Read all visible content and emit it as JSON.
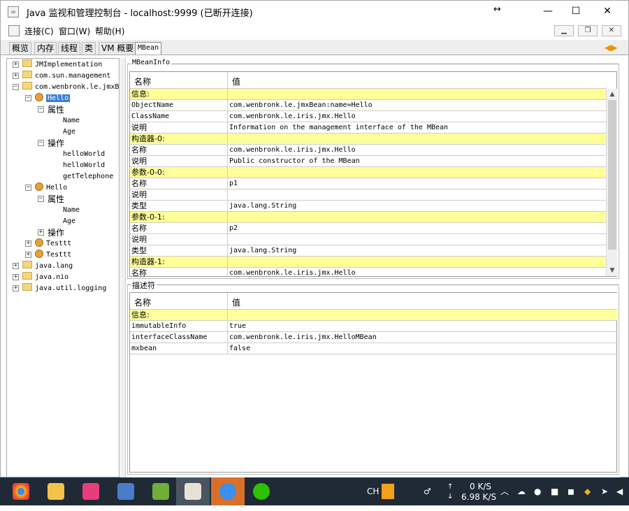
{
  "window": {
    "title": "Java 监视和管理控制台 - localhost:9999 (已断开连接)",
    "resize_glyph": "↔",
    "minimize": "—",
    "maximize": "☐",
    "close": "✕"
  },
  "menu": {
    "items": [
      "连接(C)",
      "窗口(W)",
      "帮助(H)"
    ],
    "mdi": [
      "▁",
      "❐",
      "✕"
    ]
  },
  "tabs": [
    "概览",
    "内存",
    "线程",
    "类",
    "VM 概要",
    "MBean"
  ],
  "active_tab": "MBean",
  "tab_arrows": "◀▶",
  "tree": [
    {
      "label": "JMImplementation",
      "toggle": "+",
      "icon": "folder-icon"
    },
    {
      "label": "com.sun.management",
      "toggle": "+",
      "icon": "folder-icon"
    },
    {
      "label": "com.wenbronk.le.jmxB",
      "toggle": "−",
      "icon": "folder-icon"
    },
    {
      "label": "Hello",
      "toggle": "−",
      "icon": "bean-icon",
      "selected": true
    },
    {
      "label": "属性",
      "toggle": "−",
      "icon": "none"
    },
    {
      "label": "Name",
      "toggle": "",
      "icon": "none"
    },
    {
      "label": "Age",
      "toggle": "",
      "icon": "none"
    },
    {
      "label": "操作",
      "toggle": "−",
      "icon": "none"
    },
    {
      "label": "helloWorld",
      "toggle": "",
      "icon": "none"
    },
    {
      "label": "helloWorld",
      "toggle": "",
      "icon": "none"
    },
    {
      "label": "getTelephone",
      "toggle": "",
      "icon": "none"
    },
    {
      "label": "Hello",
      "toggle": "−",
      "icon": "bean-icon"
    },
    {
      "label": "属性",
      "toggle": "−",
      "icon": "none"
    },
    {
      "label": "Name",
      "toggle": "",
      "icon": "none"
    },
    {
      "label": "Age",
      "toggle": "",
      "icon": "none"
    },
    {
      "label": "操作",
      "toggle": "+",
      "icon": "none"
    },
    {
      "label": "Testtt",
      "toggle": "+",
      "icon": "bean-icon"
    },
    {
      "label": "Testtt",
      "toggle": "+",
      "icon": "bean-icon"
    },
    {
      "label": "java.lang",
      "toggle": "+",
      "icon": "folder-icon"
    },
    {
      "label": "java.nio",
      "toggle": "+",
      "icon": "folder-icon"
    },
    {
      "label": "java.util.logging",
      "toggle": "+",
      "icon": "folder-icon"
    }
  ],
  "mbeaninfo": {
    "title": "MBeanInfo",
    "col_name": "名称",
    "col_value": "值",
    "rows": [
      {
        "name": "信息:",
        "value": "",
        "hl": true
      },
      {
        "name": "ObjectName",
        "value": "com.wenbronk.le.jmxBean:name=Hello"
      },
      {
        "name": "ClassName",
        "value": "com.wenbronk.le.iris.jmx.Hello"
      },
      {
        "name": "说明",
        "value": "Information on the management interface of the MBean"
      },
      {
        "name": "构造器-0:",
        "value": "",
        "hl": true
      },
      {
        "name": "名称",
        "value": "com.wenbronk.le.iris.jmx.Hello"
      },
      {
        "name": "说明",
        "value": "Public constructor of the MBean"
      },
      {
        "name": "参数-0-0:",
        "value": "",
        "hl": true
      },
      {
        "name": "名称",
        "value": "p1"
      },
      {
        "name": "说明",
        "value": ""
      },
      {
        "name": "类型",
        "value": "java.lang.String"
      },
      {
        "name": "参数-0-1:",
        "value": "",
        "hl": true
      },
      {
        "name": "名称",
        "value": "p2"
      },
      {
        "name": "说明",
        "value": ""
      },
      {
        "name": "类型",
        "value": "java.lang.String"
      },
      {
        "name": "构造器-1:",
        "value": "",
        "hl": true
      },
      {
        "name": "名称",
        "value": "com.wenbronk.le.iris.jmx.Hello"
      }
    ]
  },
  "descriptor": {
    "title": "描述符",
    "col_name": "名称",
    "col_value": "值",
    "rows": [
      {
        "name": "信息:",
        "value": "",
        "hl": true
      },
      {
        "name": "immutableInfo",
        "value": "true"
      },
      {
        "name": "interfaceClassName",
        "value": "com.wenbronk.le.iris.jmx.HelloMBean"
      },
      {
        "name": "mxbean",
        "value": "false"
      }
    ]
  },
  "taskbar": {
    "apps": [
      "chrome-icon",
      "file-explorer-icon",
      "intellij-icon",
      "remote-desktop-icon",
      "notepad-icon",
      "java-console-icon",
      "star-app-icon",
      "wechat-icon"
    ],
    "ime": "CH",
    "upload_speed": "0 K/S",
    "download_speed": "6.98 K/S",
    "up_arrow": "↑",
    "down_arrow": "↓"
  }
}
